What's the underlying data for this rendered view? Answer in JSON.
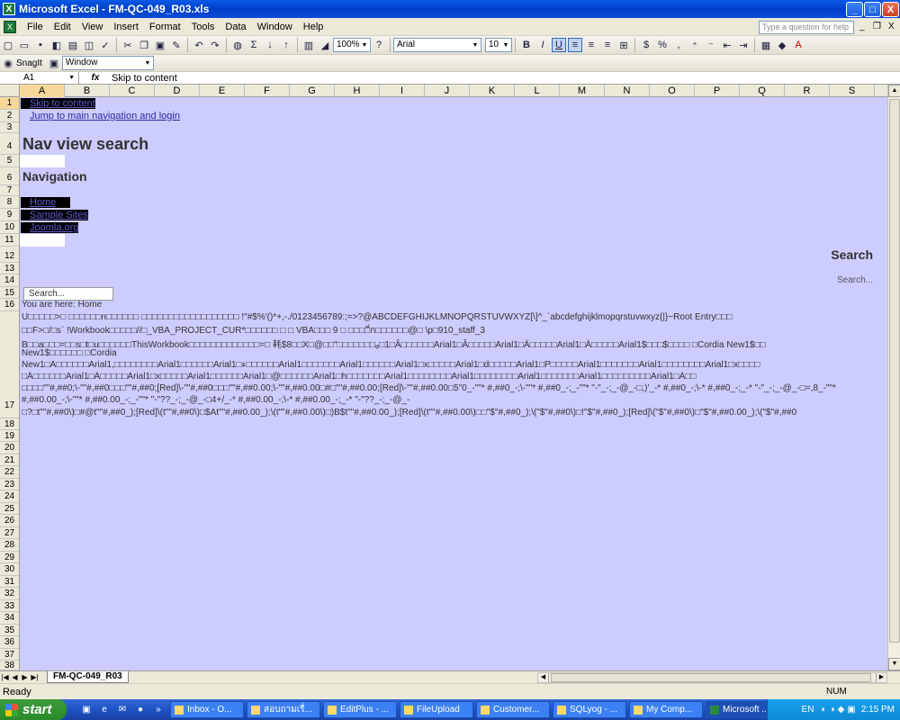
{
  "title_bar": {
    "icon": "excel-app-icon",
    "title": "Microsoft Excel - FM-QC-049_R03.xls",
    "min": "_",
    "max": "□",
    "close": "X"
  },
  "menu": {
    "items": [
      "File",
      "Edit",
      "View",
      "Insert",
      "Format",
      "Tools",
      "Data",
      "Window",
      "Help"
    ],
    "help_placeholder": "Type a question for help",
    "doc_min": "_",
    "doc_restore": "❐",
    "doc_close": "X"
  },
  "toolbar": {
    "zoom": "100%",
    "font": "Arial",
    "font_size": "10"
  },
  "toolbar2": {
    "snagit": "SnagIt",
    "window": "Window"
  },
  "formula_bar": {
    "name_box": "A1",
    "fx": "fx",
    "value": "Skip to content"
  },
  "columns": [
    "A",
    "B",
    "C",
    "D",
    "E",
    "F",
    "G",
    "H",
    "I",
    "J",
    "K",
    "L",
    "M",
    "N",
    "O",
    "P",
    "Q",
    "R",
    "S"
  ],
  "rows": [
    "1",
    "2",
    "3",
    "4",
    "5",
    "6",
    "7",
    "8",
    "9",
    "10",
    "11",
    "12",
    "13",
    "14",
    "15",
    "16",
    "17",
    "18",
    "19",
    "20",
    "21",
    "22",
    "23",
    "24",
    "25",
    "26",
    "27",
    "28",
    "29",
    "30",
    "31",
    "32",
    "33",
    "34",
    "35",
    "36",
    "37",
    "38"
  ],
  "cells": {
    "r1": "Skip to content",
    "r2": "Jump to main navigation and login",
    "r4": "Nav view search",
    "r6": "Navigation",
    "r8": "Home",
    "r9": "Sample Sites",
    "r10": "Joomla.org",
    "r12": "Search",
    "r14": "Search...",
    "r15": "Search...",
    "r16": "You are here:  Home",
    "g1": "U□□□□□>□ □□□□□□n□□□□□□ □□□□□□□□□□□□□□□□□□ !\"#$%'()*+,-./0123456789:;=>?@ABCDEFGHIJKLMNOPQRSTUVWXYZ[\\]^_`abcdefghijklmopqrstuvwxyz{|}~Root Entry□□□",
    "g2": "□□F>□/□s` !Workbook□□□□□//□_VBA_PROJECT_CUR*□□□□□□ □ □ VBA□□□ 9 □ □□□□ี่ก□□□□□□@□ \\p□910_staff_3",
    "g3": "B□□a□□□=□□s□t□u□□□□□□ThisWorkbook□□□□□□□□□□□□□=□ 耗$8□□X□@□□\"□□□□□□□ᵩ□1□Â□□□□□□Arial1□Â□□□□□Arial1□Ä□□□□□Arial1□Ä□□□□□Arial1$□□□$□□□□ □Cordia New1$□□",
    "g4": "New1$□□□□□□ □Cordia",
    "g5": "New1□Â□□□□□□Arial1,□□□□□□□□Arial1□□□□□□Arial1□ء□□□□□□Arial1□□□□□□□Arial1□□□□□□Arial1□x□□□□□Arial1□d□□□□□Arial1□P□□□□□Arial1□□□□□□□Arial1□□□□□□□□Arial1□x□□□□",
    "g6": "□Ä□□□□□□Arial1□Ä□□□□□Arial1□x□□□□□Arial1□□□□□□Arial1□@□□□□□□Arial1□h□□□□□□□Arial1□□□□□□□□Arial1□□□□□□□□Arial1□□□□□□□Arial1□□□□□□□□□Arial1□Ä□□",
    "g7": "□□□□\"\"#,##0;\\-\"\"#,##0□□□\"\"#,##0;[Red]\\-\"\"#,##0□□□\"\"#,##0.00;\\-\"\"#,##0.00□#□\"\"#,##0.00;[Red]\\-\"\"#,##0.00□5\"0_-\"\"* #,##0_-;\\-\"\"* #,##0_-;_-\"\"* \"-\"_-;_-@_-□,)'_-* #,##0_-;\\-* #,##0_-;_-* \"-\"_-;_-@_-□=,8_-\"\"*",
    "g8": "#,##0.00_-;\\-\"\"* #,##0.00_-;_-\"\"* \"-\"??_-;_-@_-□4+/_-* #,##0.00_-;\\-* #,##0.00_-;_-* \"-\"??_-;_-@_-",
    "g9": "□?□t\"\"#,##0\\)□#@t\"\"#,##0_);[Red]\\(t\"\"#,##0\\)□$At\"\"#,##0.00_);\\(t\"\"#,##0.00\\)□)B$t\"\"#,##0.00_);[Red]\\(t\"\"#,##0.00\\)□□\"$\"#,##0_);\\(\"$\"#,##0\\)□!\"$\"#,##0_);[Red]\\(\"$\"#,##0\\)□\"$\"#,##0.00_);\\(\"$\"#,##0"
  },
  "sheet_tab": "FM-QC-049_R03",
  "status": {
    "ready": "Ready",
    "num": "NUM"
  },
  "taskbar": {
    "start": "start",
    "tasks": [
      "Inbox - O...",
      "สอบถามเรื่...",
      "EditPlus - ...",
      "FileUpload",
      "Customer...",
      "SQLyog - ...",
      "My Comp...",
      "Microsoft ..."
    ],
    "lang": "EN",
    "clock": "2:15 PM"
  }
}
